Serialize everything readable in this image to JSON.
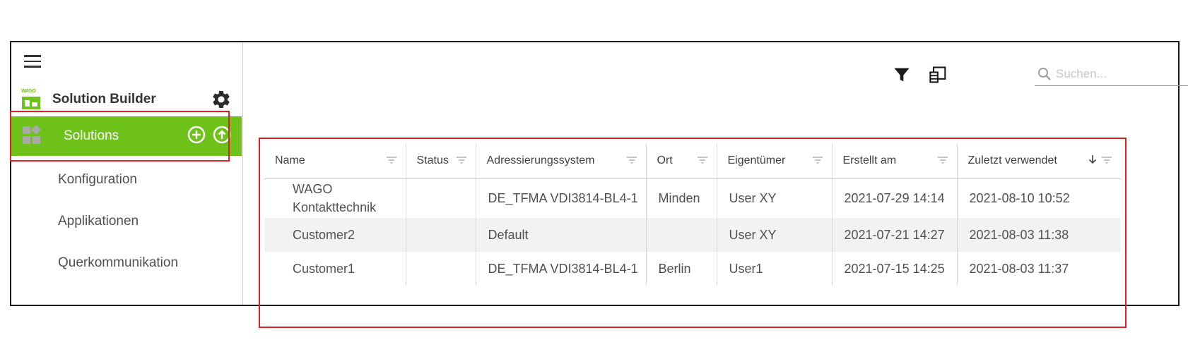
{
  "sidebar": {
    "brand": {
      "logo_text": "WAGO",
      "title": "Solution Builder"
    },
    "nav": [
      {
        "label": "Solutions",
        "active": true
      },
      {
        "label": "Konfiguration"
      },
      {
        "label": "Applikationen"
      },
      {
        "label": "Querkommunikation"
      }
    ]
  },
  "toolbar": {
    "icons": [
      "filter-icon",
      "columns-icon"
    ],
    "search": {
      "placeholder": "Suchen...",
      "value": ""
    }
  },
  "table": {
    "columns": [
      {
        "label": "Name"
      },
      {
        "label": "Status"
      },
      {
        "label": "Adressierungssystem"
      },
      {
        "label": "Ort"
      },
      {
        "label": "Eigentümer"
      },
      {
        "label": "Erstellt am"
      },
      {
        "label": "Zuletzt verwendet",
        "sort": "descending"
      }
    ],
    "rows": [
      {
        "name": "WAGO Kontakttechnik",
        "status": "",
        "addressing": "DE_TFMA VDI3814-BL4-1",
        "location": "Minden",
        "owner": "User XY",
        "created": "2021-07-29 14:14",
        "last_used": "2021-08-10 10:52"
      },
      {
        "name": "Customer2",
        "status": "",
        "addressing": "Default",
        "location": "",
        "owner": "User XY",
        "created": "2021-07-21 14:27",
        "last_used": "2021-08-03 11:38"
      },
      {
        "name": "Customer1",
        "status": "",
        "addressing": "DE_TFMA VDI3814-BL4-1",
        "location": "Berlin",
        "owner": "User1",
        "created": "2021-07-15 14:25",
        "last_used": "2021-08-03 11:37"
      }
    ]
  },
  "colors": {
    "accent": "#6ec21a",
    "highlight_outline": "#e02020",
    "row_shade": "#f2f2f2"
  }
}
